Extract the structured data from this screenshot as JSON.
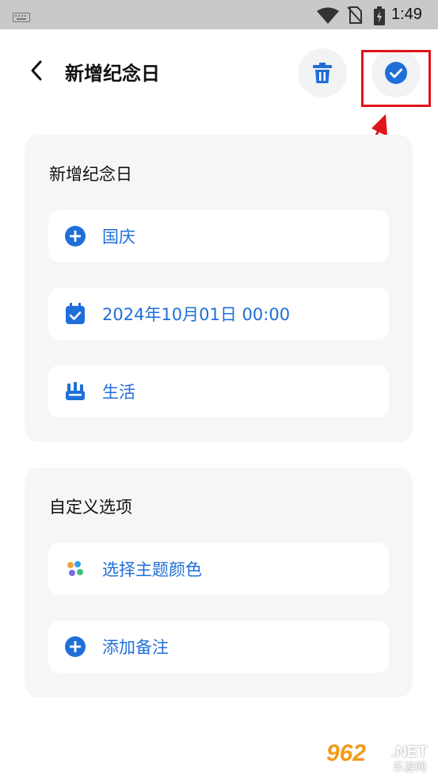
{
  "status_bar": {
    "time": "1:49"
  },
  "header": {
    "title": "新增纪念日"
  },
  "card1": {
    "title": "新增纪念日",
    "rows": [
      {
        "label": "国庆",
        "icon": "plus-circle-icon"
      },
      {
        "label": "2024年10月01日 00:00",
        "icon": "calendar-check-icon"
      },
      {
        "label": "生活",
        "icon": "category-icon"
      }
    ]
  },
  "card2": {
    "title": "自定义选项",
    "rows": [
      {
        "label": "选择主题颜色",
        "icon": "palette-icon"
      },
      {
        "label": "添加备注",
        "icon": "plus-circle-icon"
      }
    ]
  },
  "watermark": {
    "main": "962",
    "net": ".NET",
    "sub": "乐游网"
  },
  "colors": {
    "accent": "#1f6fd8",
    "card_bg": "#f6f6f8",
    "highlight": "#e0141b"
  }
}
